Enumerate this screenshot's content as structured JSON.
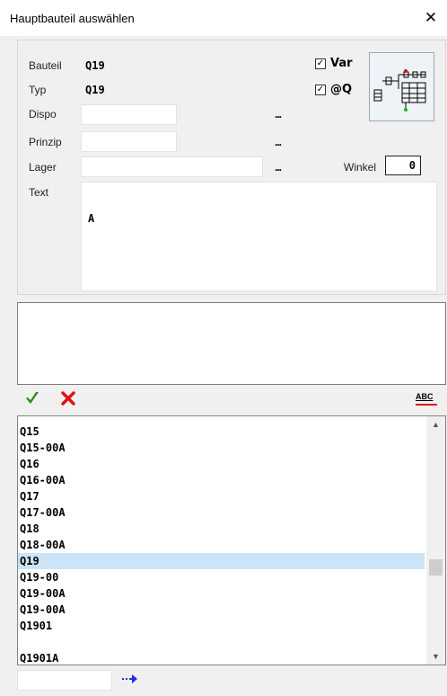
{
  "window": {
    "title": "Hauptbauteil auswählen",
    "close_symbol": "✕"
  },
  "form": {
    "bauteil_label": "Bauteil",
    "bauteil_value": "Q19",
    "typ_label": "Typ",
    "typ_value": "Q19",
    "dispo_label": "Dispo",
    "dispo_value": "",
    "prinzip_label": "Prinzip",
    "prinzip_value": "",
    "lager_label": "Lager",
    "lager_value": "",
    "browse_label": "...",
    "winkel_label": "Winkel",
    "winkel_value": "0",
    "text_label": "Text",
    "text_value": "A"
  },
  "checkboxes": {
    "var": {
      "label": "Var",
      "checked": true
    },
    "atq": {
      "label": "@Q",
      "checked": true
    }
  },
  "toolbar": {
    "spellcheck_label": "ABC"
  },
  "list": {
    "items": [
      "Q15",
      "Q15-00A",
      "Q16",
      "Q16-00A",
      "Q17",
      "Q17-00A",
      "Q18",
      "Q18-00A",
      "Q19",
      "Q19-00",
      "Q19-00A",
      "Q19-00A",
      "Q1901",
      "",
      "Q1901A"
    ],
    "selected_index": 8
  },
  "search": {
    "value": ""
  },
  "colors": {
    "accept": "#2e8b1a",
    "cancel": "#e01010",
    "selection": "#cce4f7",
    "go_arrow": "#1a2ee0"
  }
}
